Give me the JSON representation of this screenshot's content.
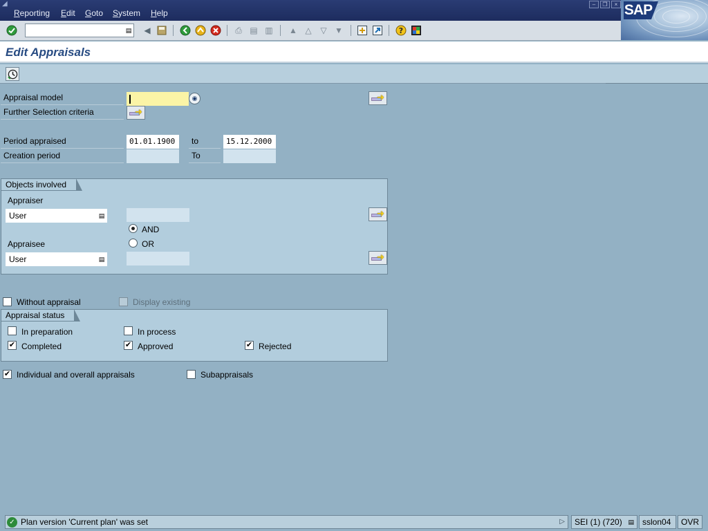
{
  "menubar": {
    "items": [
      {
        "label": "Reporting",
        "accel": "R",
        "rest": "eporting"
      },
      {
        "label": "Edit",
        "accel": "E",
        "rest": "dit"
      },
      {
        "label": "Goto",
        "accel": "G",
        "rest": "oto"
      },
      {
        "label": "System",
        "accel": "S",
        "rest": "ystem"
      },
      {
        "label": "Help",
        "accel": "H",
        "rest": "elp"
      }
    ],
    "logo_text": "SAP"
  },
  "toolbar": {
    "command_value": ""
  },
  "title": "Edit Appraisals",
  "form": {
    "appraisal_model_label": "Appraisal model",
    "appraisal_model_value": "",
    "further_selection_label": "Further Selection criteria",
    "period_appraised_label": "Period appraised",
    "period_from": "01.01.1900",
    "period_to_label": "to",
    "period_to": "15.12.2000",
    "creation_period_label": "Creation period",
    "creation_from": "",
    "creation_to_label": "To",
    "creation_to": ""
  },
  "objects": {
    "title": "Objects involved",
    "appraiser_label": "Appraiser",
    "appraiser_type": "User",
    "appraiser_value": "",
    "and_label": "AND",
    "or_label": "OR",
    "logic_selected": "AND",
    "appraisee_label": "Appraisee",
    "appraisee_type": "User",
    "appraisee_value": ""
  },
  "options": {
    "without_appraisal_label": "Without appraisal",
    "without_appraisal_checked": false,
    "display_existing_label": "Display existing",
    "display_existing_checked": false
  },
  "status_group": {
    "title": "Appraisal status",
    "items": [
      {
        "label": "In preparation",
        "checked": false
      },
      {
        "label": "In process",
        "checked": false
      },
      {
        "label": "Completed",
        "checked": true
      },
      {
        "label": "Approved",
        "checked": true
      },
      {
        "label": "Rejected",
        "checked": true
      }
    ]
  },
  "bottom_options": {
    "individual_label": "Individual and overall appraisals",
    "individual_checked": true,
    "sub_label": "Subappraisals",
    "sub_checked": false
  },
  "statusbar": {
    "message": "Plan version 'Current plan' was set",
    "session": "SEI (1) (720)",
    "server": "sslon04",
    "mode": "OVR"
  },
  "icons": [
    "check-icon",
    "back-icon",
    "exit-icon",
    "cancel-icon",
    "save-icon",
    "print-icon",
    "find-icon",
    "find-next-icon",
    "first-page-icon",
    "prev-page-icon",
    "next-page-icon",
    "last-page-icon",
    "new-session-icon",
    "shortcut-icon",
    "help-icon",
    "customize-icon",
    "execute-icon",
    "multiple-selection-icon",
    "possible-entries-icon",
    "success-icon"
  ]
}
